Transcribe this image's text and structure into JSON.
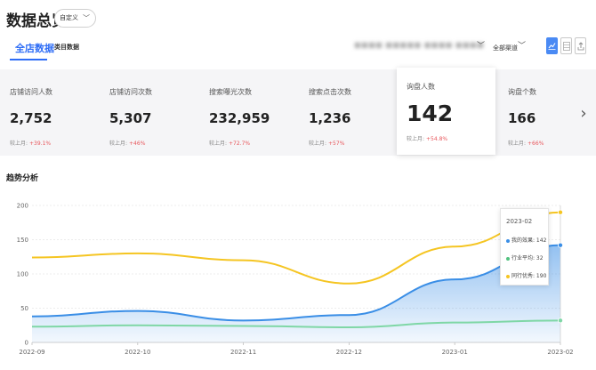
{
  "header": {
    "title": "数据总览",
    "range_label": "自定义"
  },
  "tabs": [
    {
      "label": "全店数据",
      "active": true
    },
    {
      "label": "类目数据",
      "active": false
    }
  ],
  "filters": {
    "shop_label": "■■■■ ■■■■■ ■■■■ ■■■■",
    "channel_label": "全部渠道"
  },
  "view_buttons": {
    "chart_icon": "line-chart-icon",
    "table_icon": "table-icon",
    "export_icon": "export-icon",
    "active_color": "#4a8af4"
  },
  "metrics": [
    {
      "label": "店铺访问人数",
      "value": "2,752",
      "compare_label": "较上月:",
      "compare_value": "+39.1%"
    },
    {
      "label": "店铺访问次数",
      "value": "5,307",
      "compare_label": "较上月:",
      "compare_value": "+46%"
    },
    {
      "label": "搜索曝光次数",
      "value": "232,959",
      "compare_label": "较上月:",
      "compare_value": "+72.7%"
    },
    {
      "label": "搜索点击次数",
      "value": "1,236",
      "compare_label": "较上月:",
      "compare_value": "+57%"
    },
    {
      "label": "询盘人数",
      "value": "142",
      "compare_label": "较上月:",
      "compare_value": "+54.8%",
      "selected": true
    },
    {
      "label": "询盘个数",
      "value": "166",
      "compare_label": "较上月:",
      "compare_value": "+66%"
    }
  ],
  "trend": {
    "title": "趋势分析"
  },
  "chart_data": {
    "type": "line",
    "x": [
      "2022-09",
      "2022-10",
      "2022-11",
      "2022-12",
      "2023-01",
      "2023-02"
    ],
    "ylim": [
      0,
      200
    ],
    "yticks": [
      0,
      50,
      100,
      150,
      200
    ],
    "grid": true,
    "series": [
      {
        "name": "我的效果",
        "values": [
          38,
          46,
          32,
          40,
          92,
          142
        ],
        "color": "#3a8ee6",
        "area": true
      },
      {
        "name": "行业平均",
        "values": [
          23,
          25,
          24,
          22,
          29,
          32
        ],
        "color": "#7fd7a6"
      },
      {
        "name": "同行优秀",
        "values": [
          124,
          130,
          120,
          86,
          140,
          190
        ],
        "color": "#f5c522"
      }
    ],
    "tooltip": {
      "date": "2023-02",
      "rows": [
        {
          "label": "我的效果: 142",
          "color": "#3a8ee6"
        },
        {
          "label": "行业平均: 32",
          "color": "#52c27f"
        },
        {
          "label": "同行优秀: 190",
          "color": "#f5c522"
        }
      ]
    }
  }
}
